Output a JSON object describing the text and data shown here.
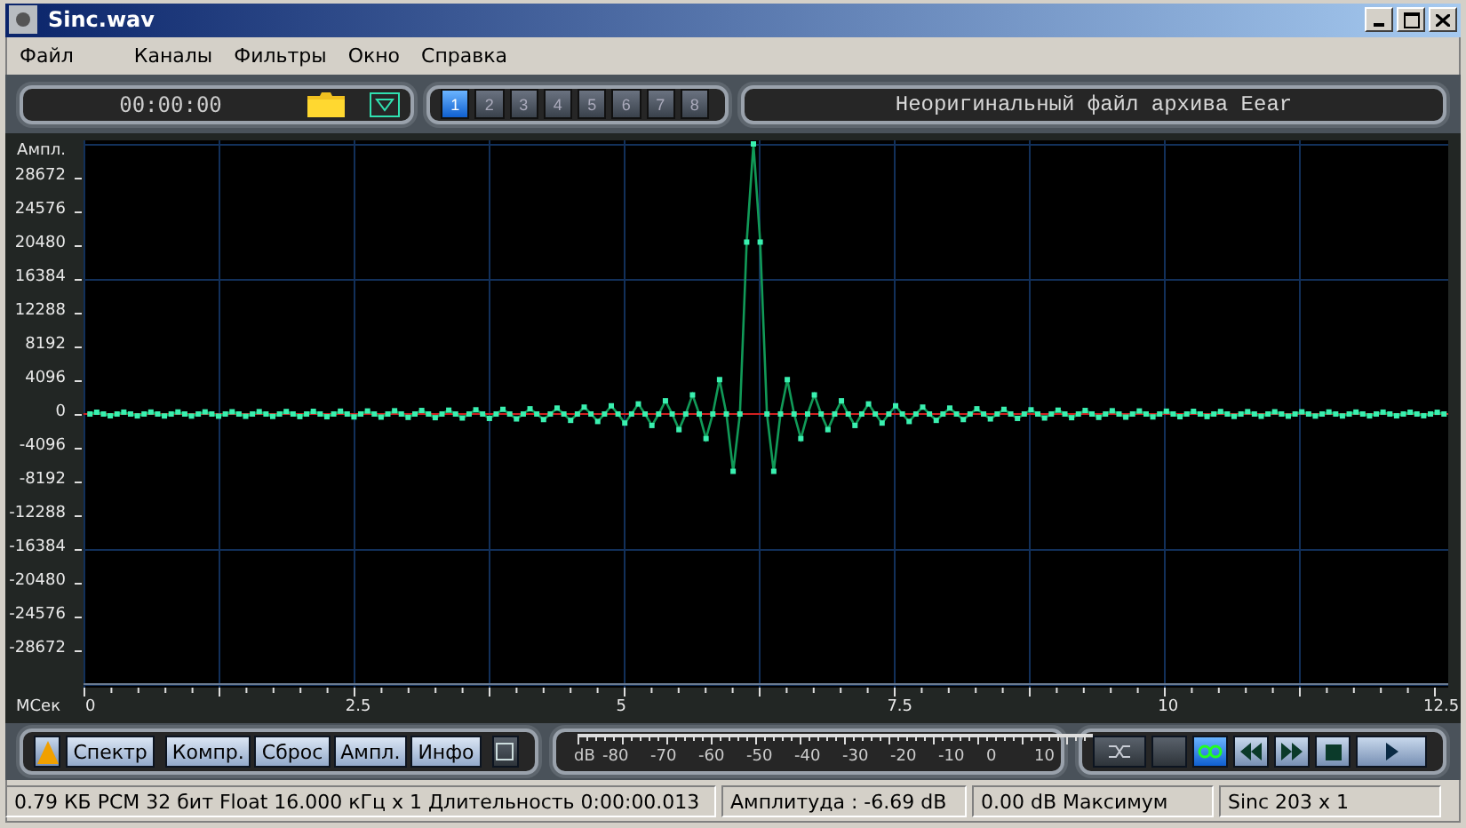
{
  "window": {
    "title": "Sinc.wav"
  },
  "menu": [
    "Файл",
    "Каналы",
    "Фильтры",
    "Окно",
    "Справка"
  ],
  "toolbar": {
    "time": "00:00:00",
    "channels": [
      {
        "label": "1",
        "selected": true
      },
      {
        "label": "2",
        "selected": false
      },
      {
        "label": "3",
        "selected": false
      },
      {
        "label": "4",
        "selected": false
      },
      {
        "label": "5",
        "selected": false
      },
      {
        "label": "6",
        "selected": false
      },
      {
        "label": "7",
        "selected": false
      },
      {
        "label": "8",
        "selected": false
      }
    ],
    "message": "Неоригинальный файл архива Eear"
  },
  "waveform": {
    "y_label": "Ампл.",
    "y_ticks": [
      "28672",
      "24576",
      "20480",
      "16384",
      "12288",
      "8192",
      "4096",
      "0",
      "-4096",
      "-8192",
      "-12288",
      "-16384",
      "-20480",
      "-24576",
      "-28672"
    ],
    "x_label": "МСек",
    "x_ticks": [
      "0",
      "2.5",
      "5",
      "7.5",
      "10",
      "12.5"
    ]
  },
  "controls": {
    "buttons": [
      "Спектр",
      "Компр.",
      "Сброс",
      "Ампл.",
      "Инфо"
    ],
    "meter": {
      "unit": "dB",
      "ticks": [
        "-80",
        "-70",
        "-60",
        "-50",
        "-40",
        "-30",
        "-20",
        "-10",
        "0",
        "10"
      ]
    },
    "transport": [
      {
        "kind": "shuffle",
        "on": false
      },
      {
        "kind": "blank",
        "on": false
      },
      {
        "kind": "loop",
        "on": true
      },
      {
        "kind": "rewind",
        "on": false
      },
      {
        "kind": "forward",
        "on": false
      },
      {
        "kind": "stop",
        "on": false
      },
      {
        "kind": "play",
        "on": false
      }
    ]
  },
  "status_bar": [
    "0.79 КБ PCM 32 бит Float 16.000 кГц x 1  Длительность 0:00:00.013",
    "Амплитуда : -6.69 dB",
    "0.00 dB Максимум",
    "Sinc 203 x 1"
  ]
}
